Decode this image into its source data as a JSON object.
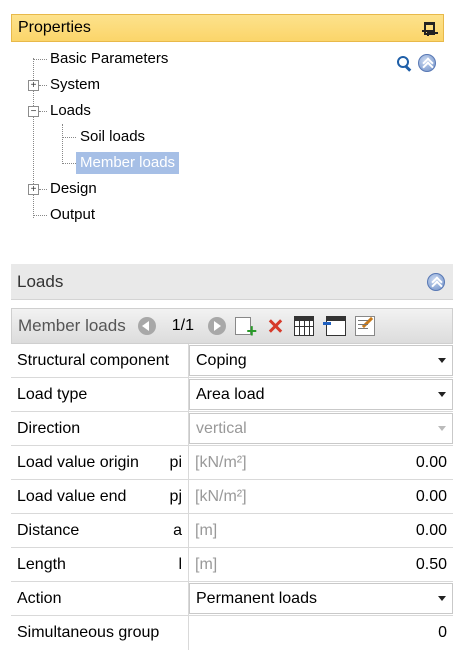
{
  "properties": {
    "title": "Properties",
    "tree": [
      {
        "label": "Basic Parameters",
        "expander": ""
      },
      {
        "label": "System",
        "expander": "+"
      },
      {
        "label": "Loads",
        "expander": "−"
      },
      {
        "label": "Soil loads",
        "expander": ""
      },
      {
        "label": "Member loads",
        "expander": "",
        "selected": true
      },
      {
        "label": "Design",
        "expander": "+"
      },
      {
        "label": "Output",
        "expander": ""
      }
    ]
  },
  "loads_panel": {
    "title": "Loads",
    "toolbar": {
      "title": "Member loads",
      "page": "1/1"
    },
    "rows": [
      {
        "label": "Structural component",
        "symbol": "",
        "value": "Coping",
        "unit": "",
        "type": "dropdown"
      },
      {
        "label": "Load type",
        "symbol": "",
        "value": "Area load",
        "unit": "",
        "type": "dropdown"
      },
      {
        "label": "Direction",
        "symbol": "",
        "value": "vertical",
        "unit": "",
        "type": "dropdown-disabled"
      },
      {
        "label": "Load value origin",
        "symbol": "pi",
        "value": "0.00",
        "unit": "[kN/m²]",
        "type": "number"
      },
      {
        "label": "Load value end",
        "symbol": "pj",
        "value": "0.00",
        "unit": "[kN/m²]",
        "type": "number"
      },
      {
        "label": "Distance",
        "symbol": "a",
        "value": "0.00",
        "unit": "[m]",
        "type": "number"
      },
      {
        "label": "Length",
        "symbol": "l",
        "value": "0.50",
        "unit": "[m]",
        "type": "number"
      },
      {
        "label": "Action",
        "symbol": "",
        "value": "Permanent loads",
        "unit": "",
        "type": "dropdown"
      },
      {
        "label": "Simultaneous group",
        "symbol": "",
        "value": "0",
        "unit": "",
        "type": "number"
      }
    ]
  }
}
